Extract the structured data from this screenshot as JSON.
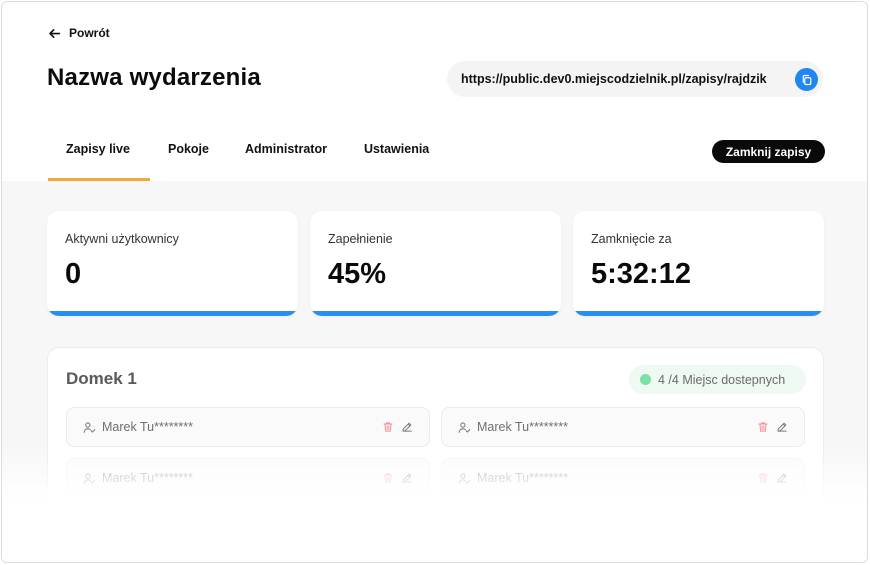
{
  "header": {
    "back_label": "Powrót",
    "event_title": "Nazwa wydarzenia",
    "url": "https://public.dev0.miejscodzielnik.pl/zapisy/rajdzik"
  },
  "tabs": [
    {
      "label": "Zapisy live",
      "active": true
    },
    {
      "label": "Pokoje",
      "active": false
    },
    {
      "label": "Administrator",
      "active": false
    },
    {
      "label": "Ustawienia",
      "active": false
    }
  ],
  "actions": {
    "close_label": "Zamknij zapisy"
  },
  "stats": [
    {
      "label": "Aktywni użytkownicy",
      "value": "0"
    },
    {
      "label": "Zapełnienie",
      "value": "45%"
    },
    {
      "label": "Zamknięcie za",
      "value": "5:32:12"
    }
  ],
  "room": {
    "name": "Domek 1",
    "availability": "4 /4 Miejsc dostepnych",
    "members": [
      {
        "name": "Marek Tu********"
      },
      {
        "name": "Marek Tu********"
      },
      {
        "name": "Marek Tu********"
      },
      {
        "name": "Marek Tu********"
      }
    ]
  },
  "colors": {
    "accent_tab": "#f2a93b",
    "stat_bar": "#2a8ef0",
    "copy_button": "#1f86f2",
    "available_dot": "#79e0a7",
    "delete_icon": "#f08c9c"
  }
}
